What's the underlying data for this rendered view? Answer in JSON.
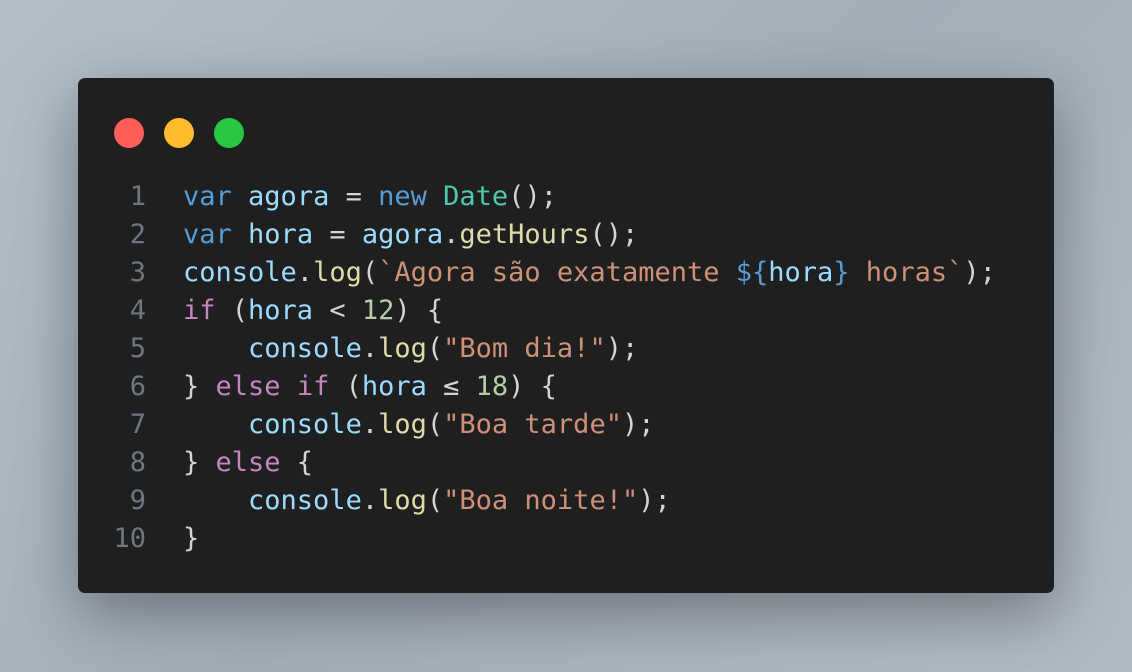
{
  "window_controls": {
    "close_color": "#ff5f57",
    "minimize_color": "#febc2e",
    "maximize_color": "#28c840"
  },
  "code": {
    "lines": [
      {
        "number": "1",
        "tokens": [
          [
            "kw",
            "var"
          ],
          [
            "p",
            " "
          ],
          [
            "var",
            "agora"
          ],
          [
            "p",
            " = "
          ],
          [
            "kw",
            "new"
          ],
          [
            "p",
            " "
          ],
          [
            "cls",
            "Date"
          ],
          [
            "p",
            "();"
          ]
        ]
      },
      {
        "number": "2",
        "tokens": [
          [
            "kw",
            "var"
          ],
          [
            "p",
            " "
          ],
          [
            "var",
            "hora"
          ],
          [
            "p",
            " = "
          ],
          [
            "var",
            "agora"
          ],
          [
            "p",
            "."
          ],
          [
            "fn",
            "getHours"
          ],
          [
            "p",
            "();"
          ]
        ]
      },
      {
        "number": "3",
        "tokens": [
          [
            "var",
            "console"
          ],
          [
            "p",
            "."
          ],
          [
            "fn",
            "log"
          ],
          [
            "p",
            "("
          ],
          [
            "str",
            "`Agora são exatamente "
          ],
          [
            "kw",
            "${"
          ],
          [
            "var",
            "hora"
          ],
          [
            "kw",
            "}"
          ],
          [
            "str",
            " horas`"
          ],
          [
            "p",
            ");"
          ]
        ]
      },
      {
        "number": "4",
        "tokens": [
          [
            "ctl",
            "if"
          ],
          [
            "p",
            " ("
          ],
          [
            "var",
            "hora"
          ],
          [
            "p",
            " < "
          ],
          [
            "num",
            "12"
          ],
          [
            "p",
            ") {"
          ]
        ]
      },
      {
        "number": "5",
        "tokens": [
          [
            "p",
            "    "
          ],
          [
            "var",
            "console"
          ],
          [
            "p",
            "."
          ],
          [
            "fn",
            "log"
          ],
          [
            "p",
            "("
          ],
          [
            "str",
            "\"Bom dia!\""
          ],
          [
            "p",
            ");"
          ]
        ]
      },
      {
        "number": "6",
        "tokens": [
          [
            "p",
            "} "
          ],
          [
            "ctl",
            "else"
          ],
          [
            "p",
            " "
          ],
          [
            "ctl",
            "if"
          ],
          [
            "p",
            " ("
          ],
          [
            "var",
            "hora"
          ],
          [
            "p",
            " ≤ "
          ],
          [
            "num",
            "18"
          ],
          [
            "p",
            ") {"
          ]
        ]
      },
      {
        "number": "7",
        "tokens": [
          [
            "p",
            "    "
          ],
          [
            "var",
            "console"
          ],
          [
            "p",
            "."
          ],
          [
            "fn",
            "log"
          ],
          [
            "p",
            "("
          ],
          [
            "str",
            "\"Boa tarde\""
          ],
          [
            "p",
            ");"
          ]
        ]
      },
      {
        "number": "8",
        "tokens": [
          [
            "p",
            "} "
          ],
          [
            "ctl",
            "else"
          ],
          [
            "p",
            " {"
          ]
        ]
      },
      {
        "number": "9",
        "tokens": [
          [
            "p",
            "    "
          ],
          [
            "var",
            "console"
          ],
          [
            "p",
            "."
          ],
          [
            "fn",
            "log"
          ],
          [
            "p",
            "("
          ],
          [
            "str",
            "\"Boa noite!\""
          ],
          [
            "p",
            ");"
          ]
        ]
      },
      {
        "number": "10",
        "tokens": [
          [
            "p",
            "}"
          ]
        ]
      }
    ]
  }
}
